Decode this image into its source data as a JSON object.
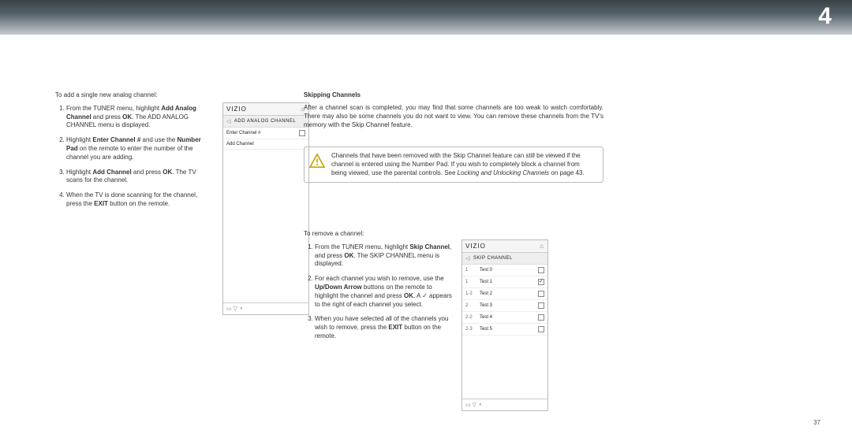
{
  "header": {
    "chapter_number": "4"
  },
  "page_number": "37",
  "left": {
    "intro": "To add a single new analog channel:",
    "steps": [
      {
        "pre": "From the TUNER menu, highlight ",
        "b1": "Add Analog Channel",
        "mid1": " and press ",
        "b2": "OK",
        "post": ". The ADD ANALOG CHANNEL menu is displayed."
      },
      {
        "pre": "Highlight ",
        "b1": "Enter Channel #",
        "mid1": " and use the ",
        "b2": "Number Pad",
        "post": " on the remote to enter the number of the channel you are adding."
      },
      {
        "pre": "Highlight ",
        "b1": "Add Channel",
        "mid1": " and press ",
        "b2": "OK",
        "post": ". The TV scans for the channel."
      },
      {
        "pre": "When the TV is done scanning for the channel, press the ",
        "b1": "EXIT",
        "post": " button on the remote."
      }
    ]
  },
  "right": {
    "heading": "Skipping Channels",
    "intro": "After a channel scan is completed, you may find that some channels are too weak to watch comfortably. There may also be some channels you do not want to view. You can remove these channels from the TV's memory with the Skip Channel feature.",
    "warn_pre": "Channels that have been removed with the Skip Channel feature can still be viewed if the channel is entered using the Number Pad. If you wish to completely block a channel from being viewed, use the parental controls. See ",
    "warn_em": "Locking and Unlocking Channels",
    "warn_post": " on page 43.",
    "remove_intro": "To remove a channel:",
    "steps": [
      {
        "pre": "From the TUNER menu, highlight ",
        "b1": "Skip Channel",
        "mid1": ", and press ",
        "b2": "OK",
        "post": ". The SKIP CHANNEL menu is displayed."
      },
      {
        "pre": "For each channel you wish to remove, use the ",
        "b1": "Up/Down Arrow",
        "mid1": " buttons on the remote to highlight the channel and press ",
        "b2": "OK",
        "post": ". A ✓ appears to the right of each channel you select."
      },
      {
        "pre": "When you have selected all of the channels you wish to remove, press the ",
        "b1": "EXIT",
        "post": " button on the remote."
      }
    ]
  },
  "panel_add": {
    "brand": "VIZIO",
    "title": "ADD ANALOG CHANNEL",
    "rows": [
      {
        "label": "Enter Channel #",
        "box": true
      },
      {
        "label": "Add Channel",
        "box": false
      }
    ]
  },
  "panel_skip": {
    "brand": "VIZIO",
    "title": "SKIP CHANNEL",
    "rows": [
      {
        "ch": "1",
        "name": "Test 0",
        "checked": false
      },
      {
        "ch": "1",
        "name": "Test 1",
        "checked": true
      },
      {
        "ch": "1-2",
        "name": "Test 2",
        "checked": false
      },
      {
        "ch": "2",
        "name": "Test 3",
        "checked": false
      },
      {
        "ch": "2-2",
        "name": "Test 4",
        "checked": false
      },
      {
        "ch": "2-3",
        "name": "Test 5",
        "checked": false
      }
    ]
  },
  "icons": {
    "footer_keys": "▭  ▽  ⚬"
  }
}
